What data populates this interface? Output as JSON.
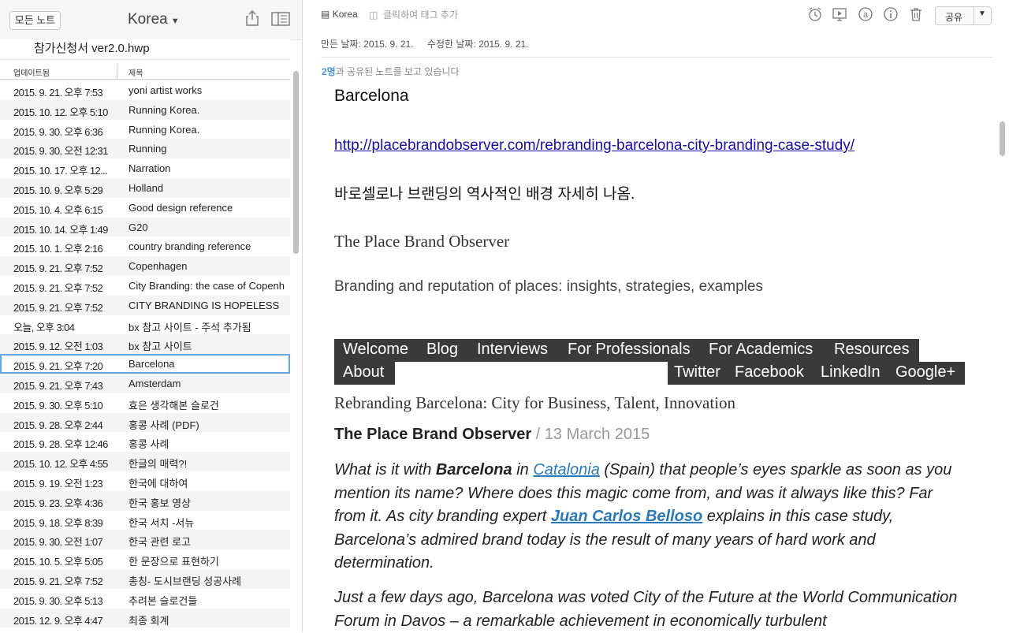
{
  "sidebar": {
    "all_notes_label": "모든 노트",
    "notebook_title": "Korea",
    "attachment_name": "참가신청서 ver2.0.hwp",
    "col_updated": "업데이트됨",
    "col_title": "제목",
    "notes": [
      {
        "date": "2015. 9. 21. 오후 7:53",
        "title": "yoni artist works"
      },
      {
        "date": "2015. 10. 12. 오후 5:10",
        "title": "Running Korea."
      },
      {
        "date": "2015. 9. 30. 오후 6:36",
        "title": "Running Korea."
      },
      {
        "date": "2015. 9. 30. 오전 12:31",
        "title": "Running"
      },
      {
        "date": "2015. 10. 17. 오후 12...",
        "title": "Narration"
      },
      {
        "date": "2015. 10. 9. 오후 5:29",
        "title": "Holland"
      },
      {
        "date": "2015. 10. 4. 오후 6:15",
        "title": "Good design reference"
      },
      {
        "date": "2015. 10. 14. 오후 1:49",
        "title": "G20"
      },
      {
        "date": "2015. 10. 1. 오후 2:16",
        "title": "country branding reference"
      },
      {
        "date": "2015. 9. 21. 오후 7:52",
        "title": "Copenhagen"
      },
      {
        "date": "2015. 9. 21. 오후 7:52",
        "title": "City Branding: the case of Copenh"
      },
      {
        "date": "2015. 9. 21. 오후 7:52",
        "title": "CITY BRANDING IS HOPELESS"
      },
      {
        "date": "오늘, 오후 3:04",
        "title": "bx 참고 사이트 - 주석 추가됨"
      },
      {
        "date": "2015. 9. 12. 오전 1:03",
        "title": "bx 참고 사이트"
      },
      {
        "date": "2015. 9. 21. 오후 7:20",
        "title": "Barcelona"
      },
      {
        "date": "2015. 9. 21. 오후 7:43",
        "title": "Amsterdam"
      },
      {
        "date": "2015. 9. 30. 오후 5:10",
        "title": "효은 생각해본 슬로건"
      },
      {
        "date": "2015. 9. 28. 오후 2:44",
        "title": "홍콩 사례 (PDF)"
      },
      {
        "date": "2015. 9. 28. 오후 12:46",
        "title": "홍콩 사례"
      },
      {
        "date": "2015. 10. 12. 오후 4:55",
        "title": "한글의 매력?!"
      },
      {
        "date": "2015. 9. 19. 오전 1:23",
        "title": "한국에 대하여"
      },
      {
        "date": "2015. 9. 23. 오후 4:36",
        "title": "한국 홍보 영상"
      },
      {
        "date": "2015. 9. 18. 오후 8:39",
        "title": "한국 서치 -서뉴"
      },
      {
        "date": "2015. 9. 30. 오전 1:07",
        "title": "한국 관련 로고"
      },
      {
        "date": "2015. 10. 5. 오후 5:05",
        "title": "한 문장으로 표현하기"
      },
      {
        "date": "2015. 9. 21. 오후 7:52",
        "title": "총칭- 도시브랜딩 성공사례"
      },
      {
        "date": "2015. 9. 30. 오후 5:13",
        "title": "추려본 슬로건들"
      },
      {
        "date": "2015. 12. 9. 오후 4:47",
        "title": "최종 회계"
      }
    ]
  },
  "toolbar": {
    "notebook": "Korea",
    "tag_placeholder": "클릭하여 태그 추가",
    "share_label": "공유",
    "icons": [
      "reminder-icon",
      "presentation-icon",
      "at-icon",
      "info-icon",
      "trash-icon"
    ]
  },
  "meta": {
    "created": "만든 날짜: 2015. 9. 21.",
    "modified": "수정한 날짜: 2015. 9. 21.",
    "shared_count": "2명",
    "shared_text": "과 공유된 노트를 보고 있습니다"
  },
  "note": {
    "title": "Barcelona",
    "link": "http://placebrandobserver.com/rebranding-barcelona-city-branding-case-study/",
    "korean_line": "바로셀로나 브랜딩의 역사적인 배경 자세히 나옴.",
    "site_name": "The Place Brand Observer",
    "tagline": "Branding and reputation of places: insights, strategies, examples",
    "nav": [
      "Welcome",
      "Blog",
      "Interviews",
      "For Professionals",
      "For Academics",
      "Resources",
      "About",
      "Twitter",
      "Facebook",
      "LinkedIn",
      "Google+"
    ],
    "headline": "Rebranding Barcelona: City for Business, Talent, Innovation",
    "byline_author": "The Place Brand Observer",
    "byline_date": " / 13 March 2015",
    "p1_a": "What is it with ",
    "p1_b": "Barcelona",
    "p1_c": " in ",
    "p1_link": "Catalonia",
    "p1_d": " (Spain) that people’s eyes sparkle as soon as you mention its name? Where does this magic come from, and was it always like this? Far from it. As city branding expert ",
    "p1_link2": "Juan Carlos Belloso",
    "p1_e": " explains in this case study, Barcelona’s admired brand today is the result of many years of hard work and determination.",
    "p2": "Just a few days ago, Barcelona was voted City of the Future at the World Communication Forum in Davos – a remarkable achievement in economically turbulent"
  }
}
